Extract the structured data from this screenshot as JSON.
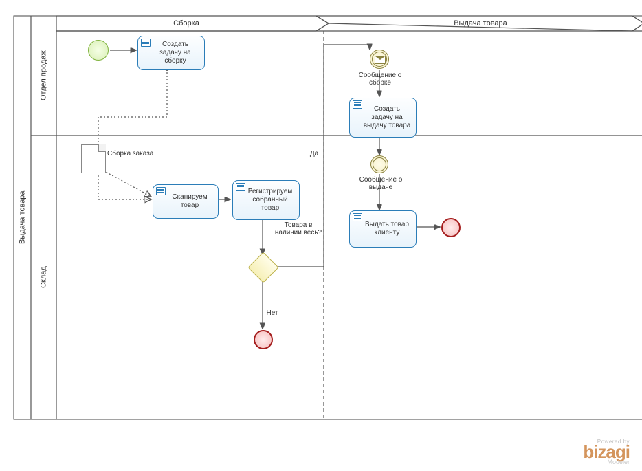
{
  "pool": "Выдача товара",
  "lanes": {
    "sales": "Отдел продаж",
    "warehouse": "Склад"
  },
  "phases": {
    "assembly": "Сборка",
    "delivery": "Выдача товара"
  },
  "tasks": {
    "create_assembly": "Создать задачу на сборку",
    "scan": "Сканируем товар",
    "register": "Регистрируем собранный товар",
    "create_delivery": "Создать задачу на выдачу товара",
    "issue": "Выдать товар клиенту"
  },
  "events": {
    "msg_assembly": "Сообщение о сборке",
    "msg_delivery": "Сообщение о выдаче"
  },
  "artifact": {
    "order": "Сборка заказа"
  },
  "gateway": {
    "label": "Товара в наличии весь?",
    "yes": "Да",
    "no": "Нет"
  },
  "brand": {
    "powered": "Powered by",
    "name": "bizagi",
    "sub": "Modeler"
  }
}
